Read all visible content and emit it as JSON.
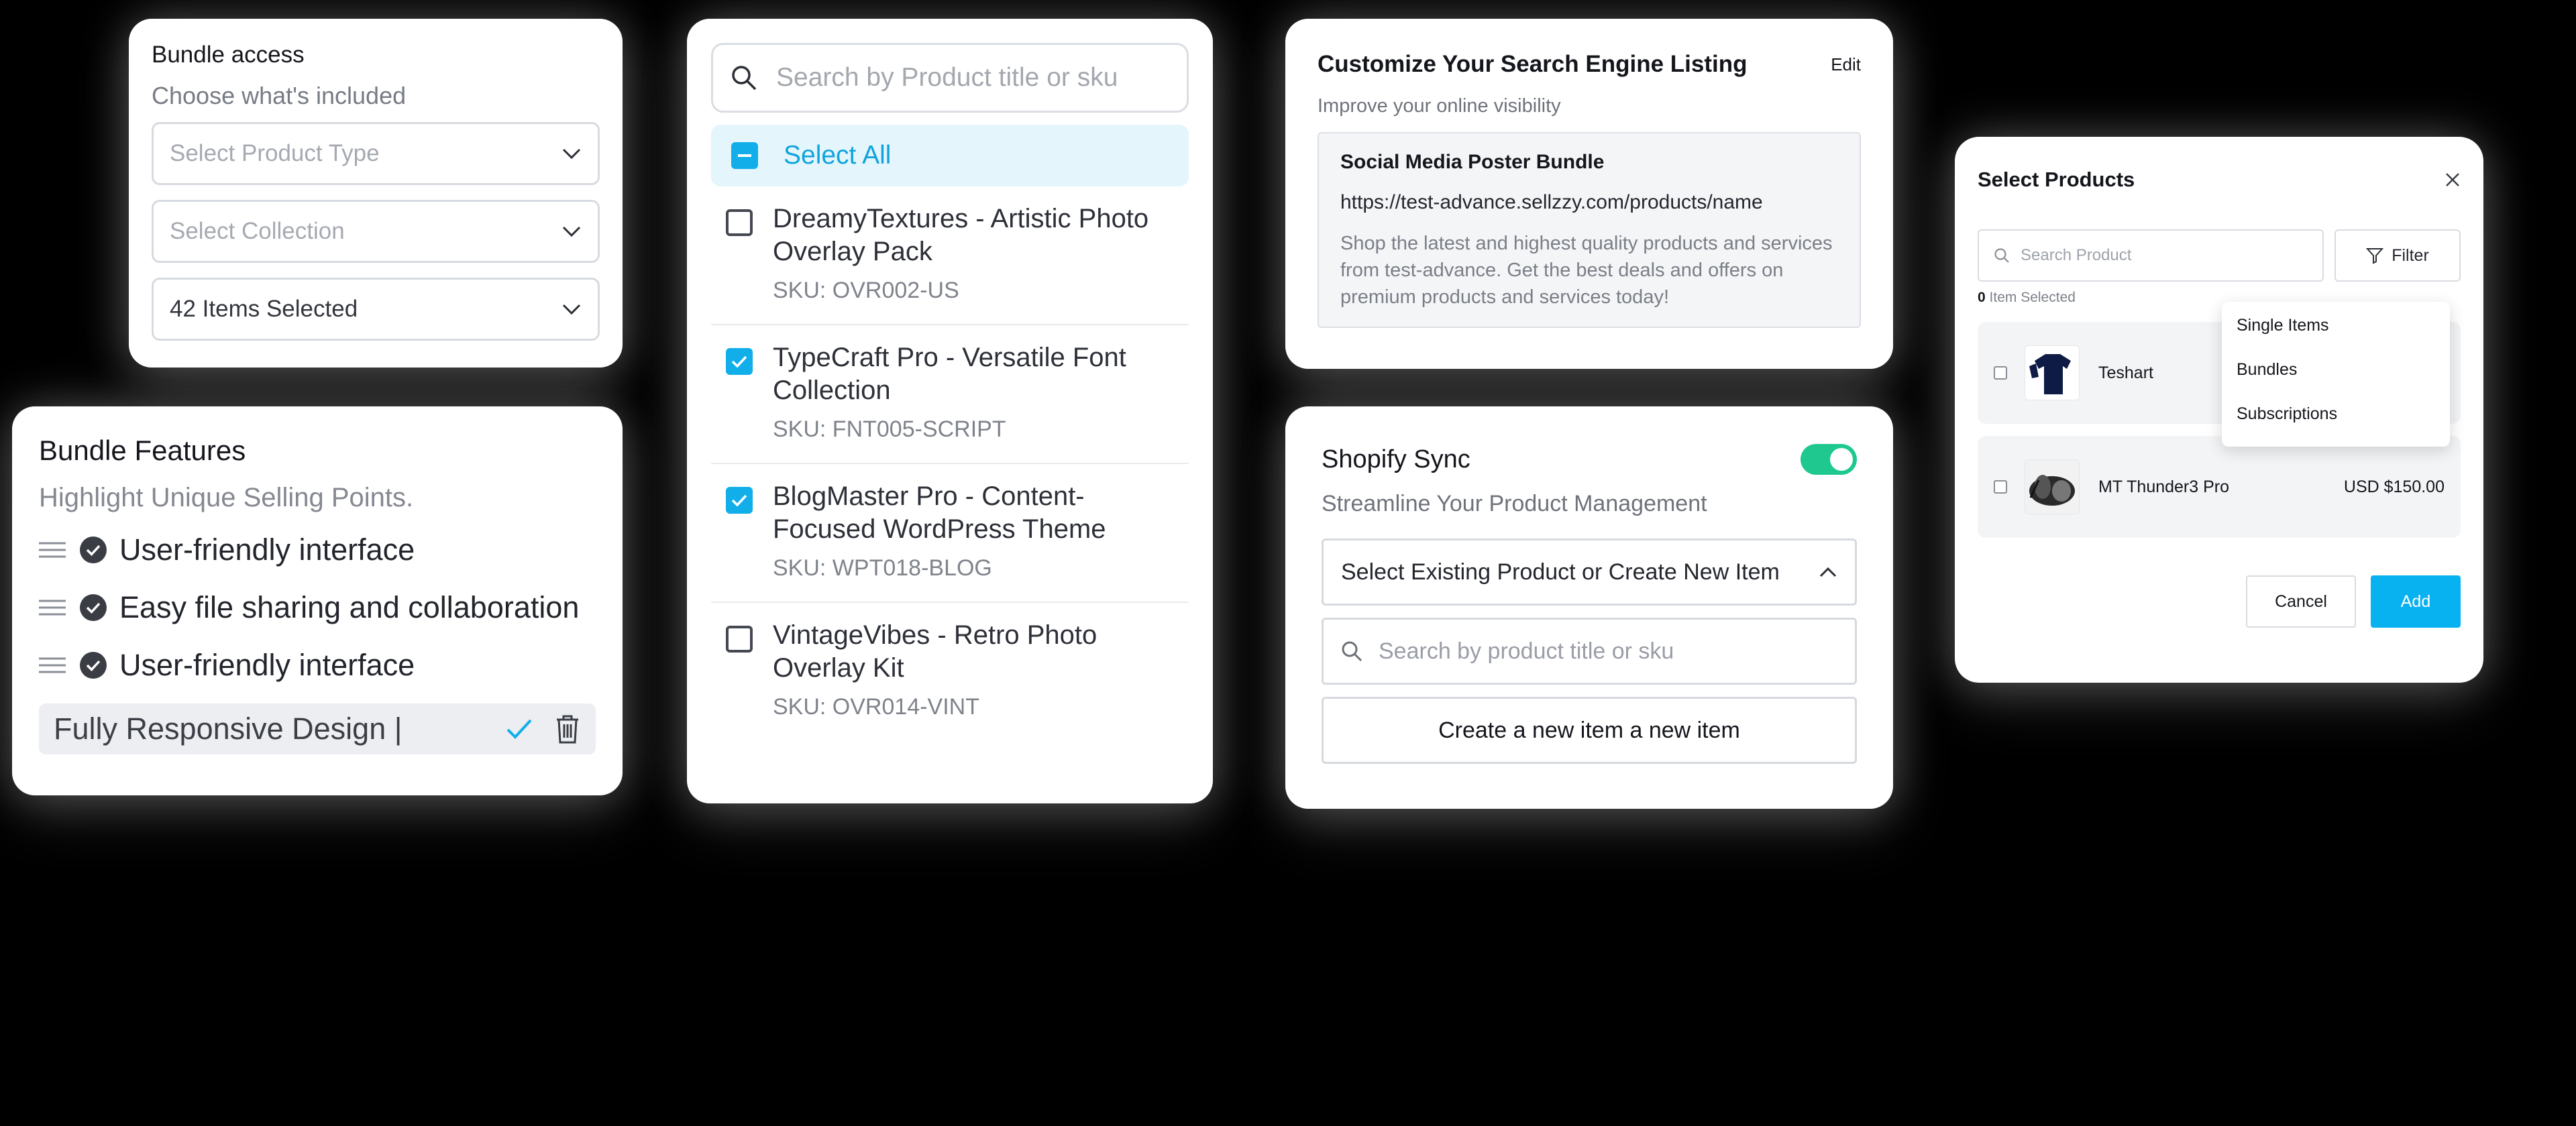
{
  "bundle_access": {
    "title": "Bundle access",
    "subtitle": "Choose what's included",
    "product_type_placeholder": "Select Product Type",
    "collection_placeholder": "Select Collection",
    "items_selected": "42 Items Selected"
  },
  "bundle_features": {
    "title": "Bundle Features",
    "subtitle": "Highlight Unique Selling Points.",
    "items": [
      {
        "label": "User-friendly interface"
      },
      {
        "label": "Easy file sharing and collaboration"
      },
      {
        "label": "User-friendly interface"
      }
    ],
    "edit_value": "Fully Responsive Design |"
  },
  "product_list": {
    "search_placeholder": "Search by Product title or sku",
    "select_all": "Select All",
    "items": [
      {
        "name": "DreamyTextures - Artistic Photo Overlay Pack",
        "sku": "SKU: OVR002-US",
        "checked": false
      },
      {
        "name": "TypeCraft Pro - Versatile Font Collection",
        "sku": "SKU: FNT005-SCRIPT",
        "checked": true
      },
      {
        "name": "BlogMaster Pro - Content-Focused WordPress Theme",
        "sku": "SKU: WPT018-BLOG",
        "checked": true
      },
      {
        "name": "VintageVibes - Retro Photo Overlay Kit",
        "sku": "SKU: OVR014-VINT",
        "checked": false
      }
    ]
  },
  "seo": {
    "title": "Customize Your Search Engine Listing",
    "edit": "Edit",
    "subtitle": "Improve your online visibility",
    "preview_title": "Social Media Poster Bundle",
    "preview_url": "https://test-advance.sellzzy.com/products/name",
    "preview_description": "Shop the latest and highest quality products and services from test-advance. Get the best deals and offers on premium products and services today!"
  },
  "shopify": {
    "title": "Shopify Sync",
    "subtitle": "Streamline Your Product Management",
    "toggle_on": true,
    "dropdown_value": "Select Existing Product or Create New Item",
    "search_placeholder": "Search by product title or sku",
    "create_button": "Create a new item a new item"
  },
  "select_products": {
    "title": "Select Products",
    "search_placeholder": "Search Product",
    "filter_label": "Filter",
    "count": "0",
    "count_label": "Item Selected",
    "filter_options": [
      "Single Items",
      "Bundles",
      "Subscriptions"
    ],
    "rows": [
      {
        "name": "Teshart",
        "price": ""
      },
      {
        "name": "MT Thunder3 Pro",
        "price": "USD $150.00"
      }
    ],
    "cancel": "Cancel",
    "add": "Add"
  },
  "colors": {
    "accent_blue": "#11aee9",
    "toggle_green": "#1ec88f",
    "background": "#000000"
  },
  "icons": [
    "chevron-down-icon",
    "chevron-up-icon",
    "search-icon",
    "drag-handle-icon",
    "check-circle-icon",
    "checkmark-icon",
    "trash-icon",
    "close-icon",
    "filter-icon"
  ]
}
